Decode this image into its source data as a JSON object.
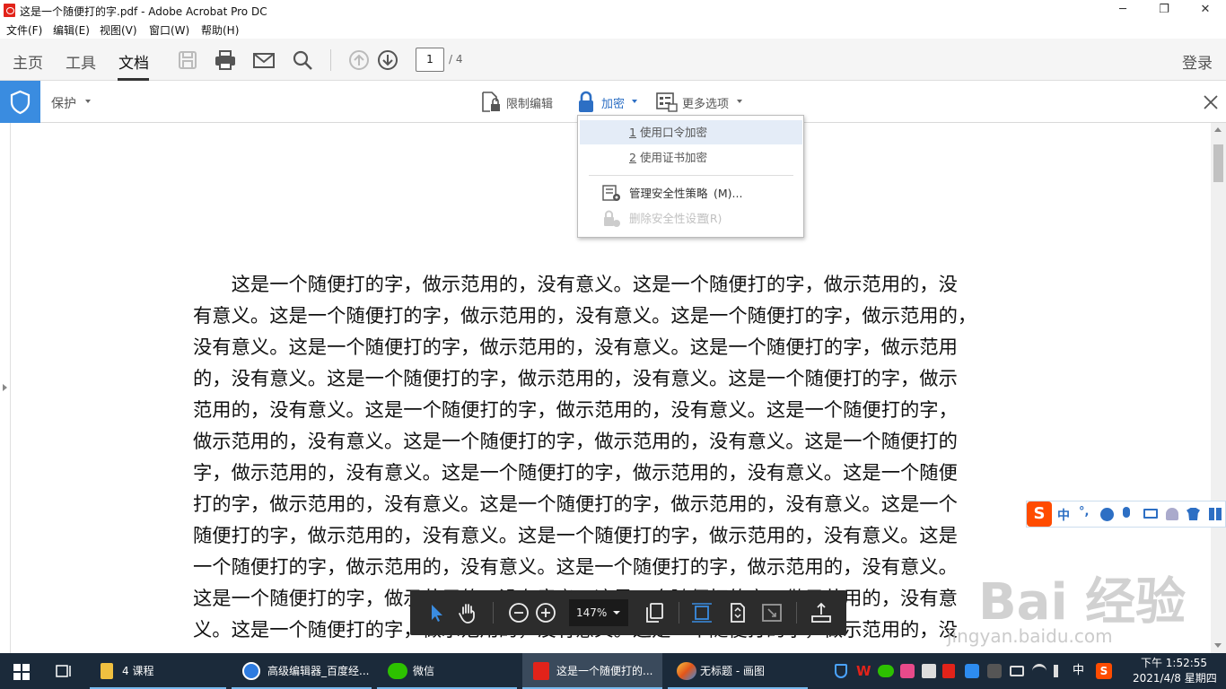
{
  "window": {
    "title": "这是一个随便打的字.pdf - Adobe Acrobat Pro DC",
    "controls": {
      "minimize": "─",
      "restore": "❐",
      "close": "✕"
    }
  },
  "menubar": [
    "文件(F)",
    "编辑(E)",
    "视图(V)",
    "窗口(W)",
    "帮助(H)"
  ],
  "toolbar": {
    "tabs": [
      "主页",
      "工具",
      "文档"
    ],
    "active_tab": "文档",
    "page_current": "1",
    "page_total": "/ 4",
    "login": "登录"
  },
  "protect_bar": {
    "label": "保护",
    "restrict_edit": "限制编辑",
    "encrypt": "加密",
    "more_options": "更多选项"
  },
  "encrypt_menu": {
    "items": [
      {
        "num": "1",
        "label": "使用口令加密",
        "highlighted": true,
        "enabled": true
      },
      {
        "num": "2",
        "label": "使用证书加密",
        "highlighted": false,
        "enabled": true
      }
    ],
    "manage": {
      "label": "管理安全性策略",
      "accel": "(M)..."
    },
    "remove": {
      "label": "删除安全性设置",
      "accel": "(R)"
    }
  },
  "document": {
    "lines": [
      "这是一个随便打的字，做示范用的，没有意义。这是一个随便打的字，做示范用的，没",
      "有意义。这是一个随便打的字，做示范用的，没有意义。这是一个随便打的字，做示范用的，",
      "没有意义。这是一个随便打的字，做示范用的，没有意义。这是一个随便打的字，做示范用",
      "的，没有意义。这是一个随便打的字，做示范用的，没有意义。这是一个随便打的字，做示",
      "范用的，没有意义。这是一个随便打的字，做示范用的，没有意义。这是一个随便打的字，",
      "做示范用的，没有意义。这是一个随便打的字，做示范用的，没有意义。这是一个随便打的",
      "字，做示范用的，没有意义。这是一个随便打的字，做示范用的，没有意义。这是一个随便",
      "打的字，做示范用的，没有意义。这是一个随便打的字，做示范用的，没有意义。这是一个",
      "随便打的字，做示范用的，没有意义。这是一个随便打的字，做示范用的，没有意义。这是",
      "一个随便打的字，做示范用的，没有意义。这是一个随便打的字，做示范用的，没有意义。",
      "这是一个随便打的字，做示范用的，没有意义。这是一个随便打的字，做示范用的，没有意",
      "义。这是一个随便打的字，做示范用的，没有意义。这是一个随便打的字，做示范用的，没"
    ]
  },
  "floating_toolbar": {
    "zoom": "147%"
  },
  "ime": {
    "mode": "中",
    "punct": "°,"
  },
  "taskbar": {
    "items": [
      {
        "label": "4 课程",
        "icon": "folder-icon"
      },
      {
        "label": "高级编辑器_百度经...",
        "icon": "browser-icon"
      },
      {
        "label": "微信",
        "icon": "wechat-icon"
      },
      {
        "label": "这是一个随便打的...",
        "icon": "acrobat-icon",
        "active": true
      },
      {
        "label": "无标题 - 画图",
        "icon": "paint-icon"
      }
    ],
    "lang": "中",
    "time": "下午 1:52:55",
    "date": "2021/4/8 星期四"
  },
  "watermark": {
    "brand": "Bai 经验",
    "url": "jingyan.baidu.com"
  },
  "colors": {
    "accent": "#3a8ce0",
    "taskbar": "#1b2a3a",
    "floatbar": "#2c2c2c",
    "acrobat_red": "#e2231a"
  }
}
